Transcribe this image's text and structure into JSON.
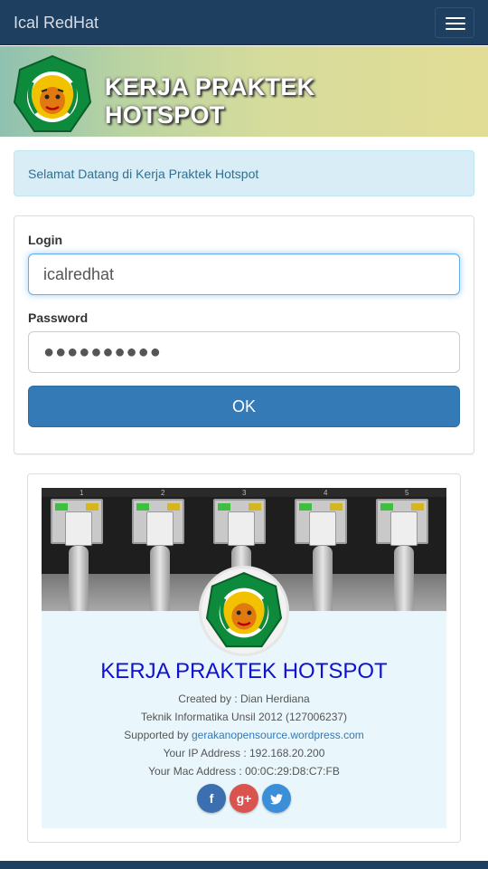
{
  "navbar": {
    "brand": "Ical RedHat",
    "menu_icon": "hamburger-menu-icon"
  },
  "banner": {
    "title_line1": "KERJA PRAKTEK",
    "title_line2": "HOTSPOT",
    "logo": "university-emblem-logo"
  },
  "alert": {
    "message": "Selamat Datang di Kerja Praktek Hotspot"
  },
  "login_form": {
    "login_label": "Login",
    "login_value": "icalredhat",
    "password_label": "Password",
    "password_masked": "●●●●●●●●●●",
    "submit_label": "OK"
  },
  "profile": {
    "port_numbers": [
      "1",
      "2",
      "3",
      "4",
      "5"
    ],
    "title": "KERJA PRAKTEK HOTSPOT",
    "created_by": "Created by : Dian Herdiana",
    "program": "Teknik Informatika Unsil 2012 (127006237)",
    "supported_prefix": "Supported by ",
    "supported_link": "gerakanopensource.wordpress.com",
    "ip_line": "Your IP Address : 192.168.20.200",
    "mac_line": "Your Mac Address : 00:0C:29:D8:C7:FB",
    "social": [
      {
        "name": "facebook",
        "glyph": "f",
        "color": "#3b6fb0"
      },
      {
        "name": "google-plus",
        "glyph": "g+",
        "color": "#d9534f"
      },
      {
        "name": "twitter",
        "glyph": "t",
        "color": "#3b8fd9"
      }
    ]
  },
  "colors": {
    "navbar": "#1f3f60",
    "primary_button": "#337ab7",
    "alert_bg": "#d9edf7",
    "title_blue": "#1010d0"
  }
}
